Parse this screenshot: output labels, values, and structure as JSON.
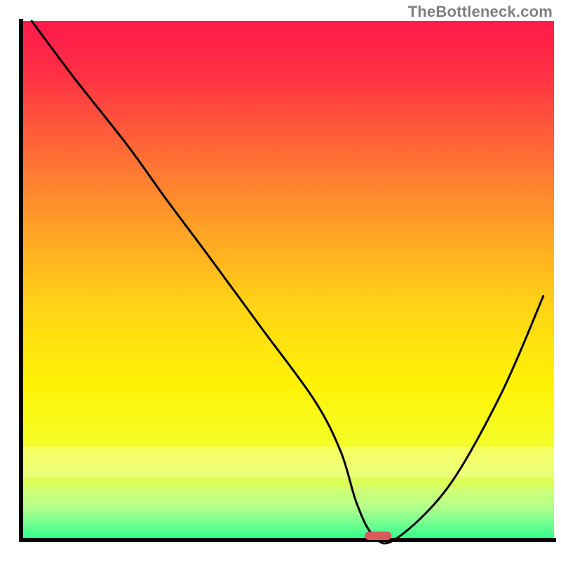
{
  "watermark": "TheBottleneck.com",
  "chart_data": {
    "type": "line",
    "title": "",
    "xlabel": "",
    "ylabel": "",
    "xlim": [
      0,
      100
    ],
    "ylim": [
      0,
      100
    ],
    "x": [
      2,
      10,
      20,
      27,
      35,
      45,
      55,
      60,
      63,
      66,
      70,
      80,
      90,
      98
    ],
    "values": [
      100,
      89,
      76,
      66,
      55,
      41,
      27,
      17,
      7,
      1,
      0,
      10,
      28,
      47
    ],
    "marker": {
      "x": 67,
      "y": 0.8,
      "width": 5,
      "height": 1.6
    },
    "background_gradient": {
      "stops": [
        {
          "offset": 0.0,
          "color": "#ff1a4a"
        },
        {
          "offset": 0.1,
          "color": "#ff2f44"
        },
        {
          "offset": 0.25,
          "color": "#ff6a36"
        },
        {
          "offset": 0.4,
          "color": "#ffa127"
        },
        {
          "offset": 0.55,
          "color": "#ffd416"
        },
        {
          "offset": 0.7,
          "color": "#fff205"
        },
        {
          "offset": 0.82,
          "color": "#f3ff2a"
        },
        {
          "offset": 0.9,
          "color": "#d8ff60"
        },
        {
          "offset": 0.95,
          "color": "#9aff90"
        },
        {
          "offset": 1.0,
          "color": "#2bff8e"
        }
      ]
    },
    "axis_color": "#000000",
    "line_color": "#000000",
    "marker_color": "#d85a5a"
  }
}
